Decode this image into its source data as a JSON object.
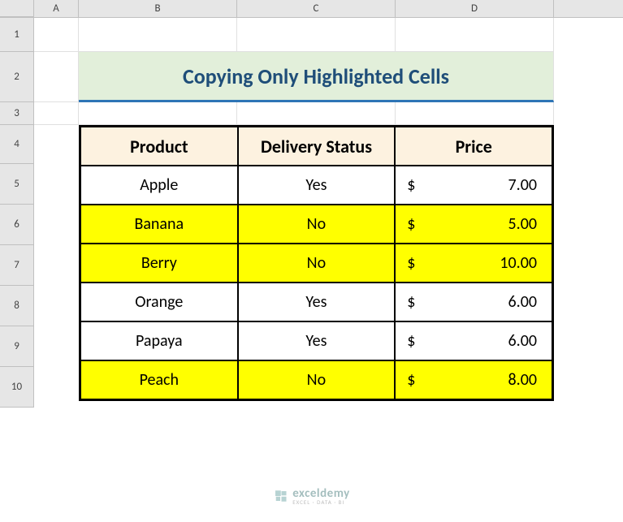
{
  "columns": [
    "A",
    "B",
    "C",
    "D"
  ],
  "rows": [
    "1",
    "2",
    "3",
    "4",
    "5",
    "6",
    "7",
    "8",
    "9",
    "10"
  ],
  "title": "Copying Only Highlighted Cells",
  "headers": {
    "product": "Product",
    "delivery": "Delivery Status",
    "price": "Price"
  },
  "currency": "$",
  "data": [
    {
      "product": "Apple",
      "delivery": "Yes",
      "price": "7.00",
      "highlighted": false
    },
    {
      "product": "Banana",
      "delivery": "No",
      "price": "5.00",
      "highlighted": true
    },
    {
      "product": "Berry",
      "delivery": "No",
      "price": "10.00",
      "highlighted": true
    },
    {
      "product": "Orange",
      "delivery": "Yes",
      "price": "6.00",
      "highlighted": false
    },
    {
      "product": "Papaya",
      "delivery": "Yes",
      "price": "6.00",
      "highlighted": false
    },
    {
      "product": "Peach",
      "delivery": "No",
      "price": "8.00",
      "highlighted": true
    }
  ],
  "watermark": {
    "name": "exceldemy",
    "subtitle": "EXCEL · DATA · BI"
  }
}
